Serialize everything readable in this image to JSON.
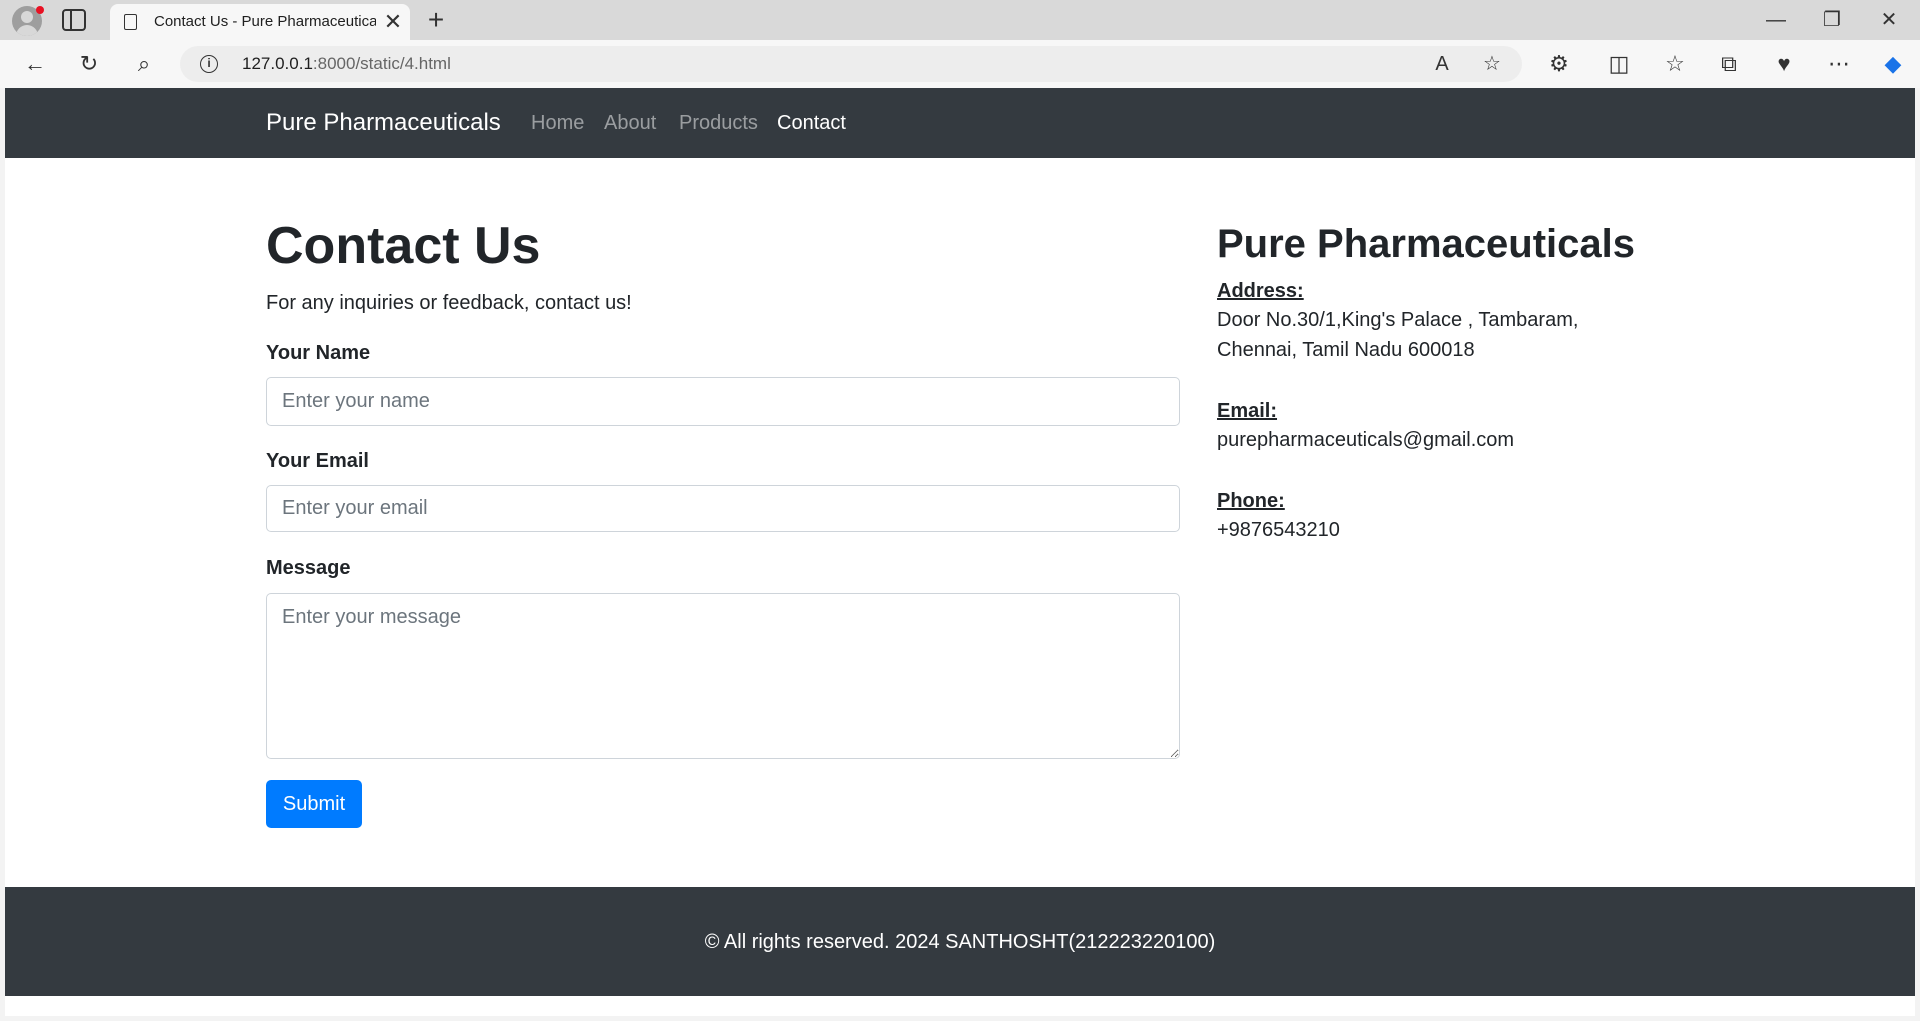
{
  "browser": {
    "tab_title": "Contact Us - Pure Pharmaceuticals",
    "url_host": "127.0.0.1",
    "url_path": ":8000/static/4.html"
  },
  "navbar": {
    "brand": "Pure Pharmaceuticals",
    "links": [
      {
        "label": "Home",
        "active": false
      },
      {
        "label": "About",
        "active": false
      },
      {
        "label": "Products",
        "active": false
      },
      {
        "label": "Contact",
        "active": true
      }
    ]
  },
  "contact": {
    "heading": "Contact Us",
    "lead": "For any inquiries or feedback, contact us!",
    "fields": {
      "name": {
        "label": "Your Name",
        "placeholder": "Enter your name",
        "value": ""
      },
      "email": {
        "label": "Your Email",
        "placeholder": "Enter your email",
        "value": ""
      },
      "message": {
        "label": "Message",
        "placeholder": "Enter your message",
        "value": ""
      }
    },
    "submit_label": "Submit"
  },
  "info": {
    "company": "Pure Pharmaceuticals",
    "address_label": "Address:",
    "address_line1": "Door No.30/1,King's Palace , Tambaram,",
    "address_line2": "Chennai, Tamil Nadu 600018",
    "email_label": "Email:",
    "email_value": "purepharmaceuticals@gmail.com",
    "phone_label": "Phone:",
    "phone_value": "+9876543210"
  },
  "footer": {
    "text": "© All rights reserved. 2024 SANTHOSHT(212223220100)"
  },
  "colors": {
    "navbar_bg": "#343a40",
    "primary": "#007bff"
  }
}
